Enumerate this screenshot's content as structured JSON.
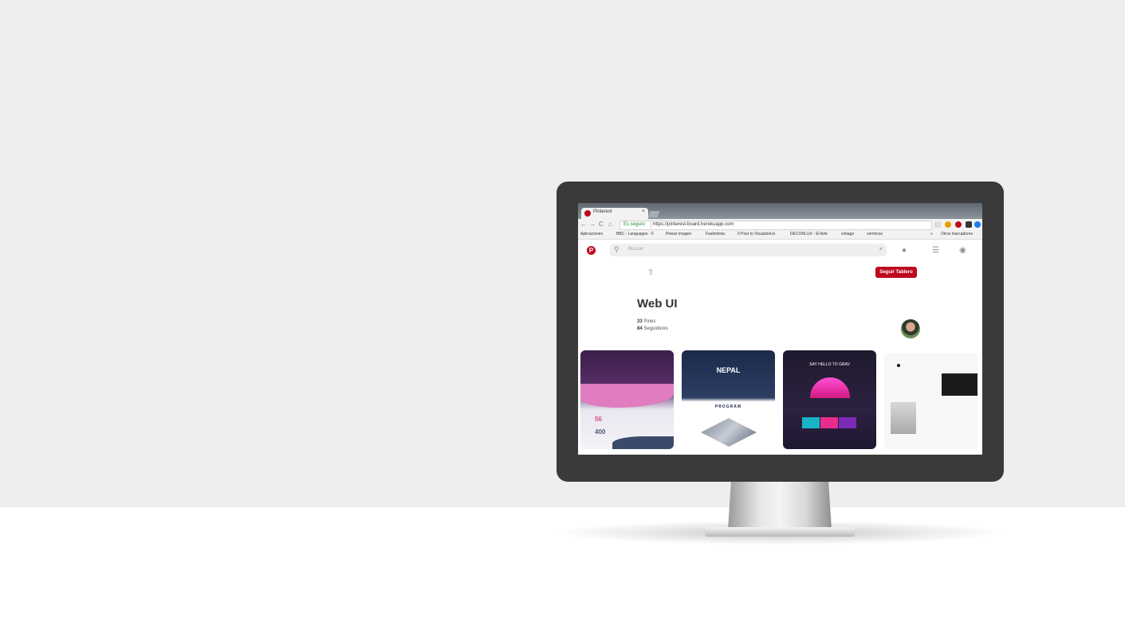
{
  "browser": {
    "tab_title": "Pinterest",
    "tab_close": "×",
    "secure_label": "Es seguro",
    "url": "https://pinterest-board.herokuapp.com",
    "nav_back": "←",
    "nav_forward": "→",
    "nav_reload": "C",
    "nav_home": "⌂",
    "bookmarks": [
      "Aplicaciones",
      "BBC - Languages - F",
      "Pinear imagen",
      "Fashiolista",
      "0 Post to VisualizeUs",
      "DECORLUX - El Arte",
      "vintage",
      "cermicos"
    ],
    "bookmarks_overflow": "»",
    "other_bookmarks": "Otros marcadores"
  },
  "pinterest": {
    "logo": "P",
    "search_placeholder": "Buscar",
    "search_clear": "×",
    "follow_button": "Seguir Tablero",
    "board_title": "Web UI",
    "pins_count": "33",
    "pins_label": "Pines",
    "followers_count": "84",
    "followers_label": "Seguidores"
  },
  "pins": {
    "pin1_num1": "56",
    "pin1_num2": "400",
    "pin2_title": "NEPAL",
    "pin2_program": "PROGRAM",
    "pin3_title": "SAY HELLO TO GRAV"
  },
  "colors": {
    "brand": "#bd081c",
    "wall": "#eeeeee",
    "monitor_bezel": "#3a3a3a"
  },
  "icons": {
    "search": "search-icon",
    "user": "user-icon",
    "menu": "menu-icon",
    "chat": "chat-icon",
    "share": "share-icon"
  }
}
